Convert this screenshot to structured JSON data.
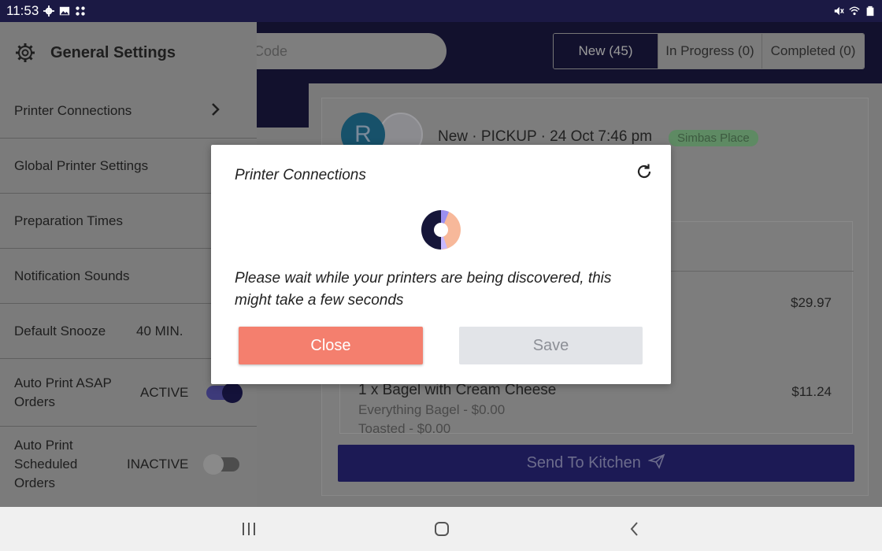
{
  "status_bar": {
    "time": "11:53",
    "left_icons": [
      "gear-icon",
      "image-icon",
      "apps-icon"
    ],
    "right_icons": [
      "mute-icon",
      "wifi-icon",
      "battery-icon"
    ]
  },
  "header": {
    "search_placeholder": "Code",
    "tabs": [
      {
        "label": "New (45)",
        "active": true
      },
      {
        "label": "In Progress (0)",
        "active": false
      },
      {
        "label": "Completed (0)",
        "active": false
      }
    ]
  },
  "order": {
    "avatar_letter": "R",
    "title": "New · PICKUP · 24 Oct 7:46 pm",
    "store_badge": "Simbas Place",
    "price_first": "$29.97",
    "item_name": "1 x Bagel with Cream Cheese",
    "item_price": "$11.24",
    "item_options": [
      "Everything Bagel - $0.00",
      "Toasted - $0.00"
    ],
    "send_button": "Send To Kitchen"
  },
  "drawer": {
    "title": "General Settings",
    "items": [
      {
        "label": "Printer Connections"
      },
      {
        "label": "Global Printer Settings"
      },
      {
        "label": "Preparation Times"
      },
      {
        "label": "Notification Sounds"
      },
      {
        "label": "Default Snooze",
        "value": "40 MIN."
      },
      {
        "label": "Auto Print ASAP Orders",
        "status": "ACTIVE",
        "enabled": true
      },
      {
        "label": "Auto Print Scheduled Orders",
        "status": "INACTIVE",
        "enabled": false
      }
    ]
  },
  "modal": {
    "title": "Printer Connections",
    "message": "Please wait while your printers are being discovered, this might take a few seconds",
    "close_label": "Close",
    "save_label": "Save"
  },
  "colors": {
    "brand_dark": "#12112d",
    "close_button": "#f47f6e",
    "send_button": "#1c1a55"
  }
}
